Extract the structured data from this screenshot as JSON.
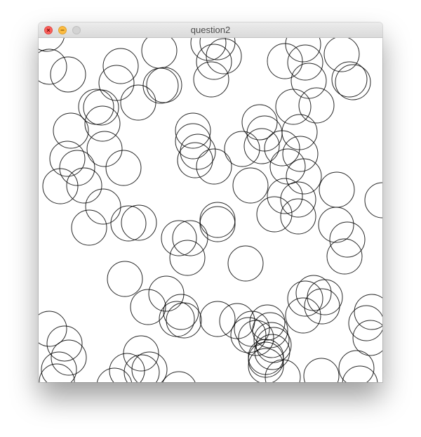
{
  "window": {
    "title": "question2",
    "buttons": {
      "close_icon": "close-icon",
      "minimize_icon": "minimize-icon",
      "zoom_icon": "zoom-icon"
    },
    "colors": {
      "close": "#fc605c",
      "minimize": "#fdbc40",
      "zoom_disabled": "#d3d3d3"
    }
  },
  "canvas": {
    "background": "#ffffff",
    "stroke": "#000000"
  }
}
